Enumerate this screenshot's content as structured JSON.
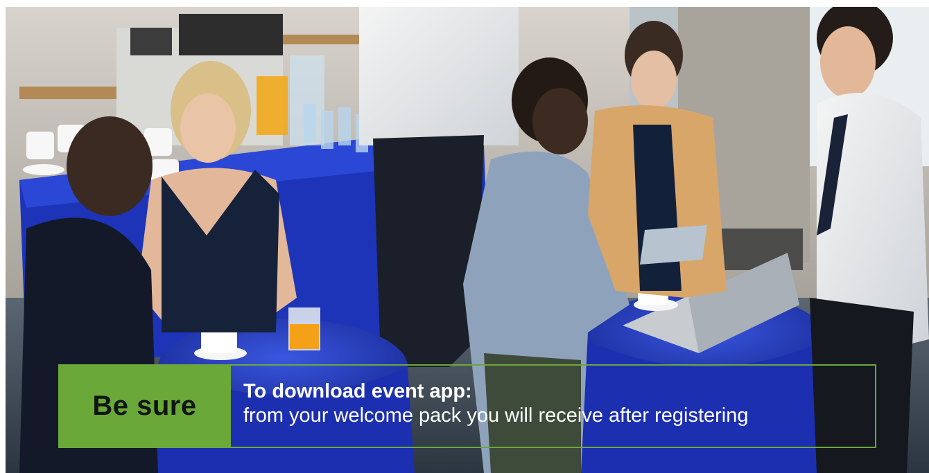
{
  "scene": {
    "image_label": "business people networking at event coffee break"
  },
  "callout": {
    "badge_label": "Be sure",
    "title": "To download event app:",
    "subtitle": "from your welcome pack you will receive after registering",
    "accent_color": "#6aa83a"
  }
}
